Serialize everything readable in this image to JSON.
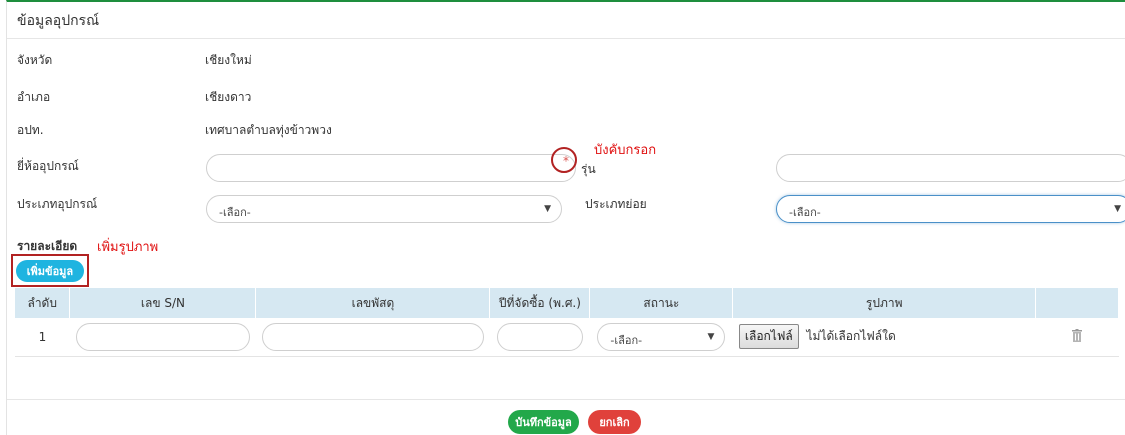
{
  "panel": {
    "title": "ข้อมูลอุปกรณ์"
  },
  "info": {
    "province_label": "จังหวัด",
    "province_value": "เชียงใหม่",
    "district_label": "อำเภอ",
    "district_value": "เชียงดาว",
    "org_label": "อปท.",
    "org_value": "เทศบาลตำบลทุ่งข้าวพวง"
  },
  "form": {
    "brand_label": "ยี่ห้ออุปกรณ์",
    "required_star": "*",
    "model_label": "รุ่น",
    "type_label": "ประเภทอุปกรณ์",
    "type_value": "-เลือก-",
    "subtype_label": "ประเภทย่อย",
    "subtype_value": "-เลือก-"
  },
  "annotations": {
    "required_note": "บังคับกรอก",
    "add_image_note": "เพิ่มรูปภาพ"
  },
  "details": {
    "heading": "รายละเอียด",
    "add_button": "เพิ่มข้อมูล"
  },
  "table": {
    "headers": {
      "no": "ลำดับ",
      "sn": "เลข S/N",
      "asset_no": "เลขพัสดุ",
      "year": "ปีที่จัดซื้อ (พ.ศ.)",
      "status": "สถานะ",
      "image": "รูปภาพ"
    },
    "rows": [
      {
        "no": "1",
        "status": "-เลือก-",
        "file_button": "เลือกไฟล์",
        "file_text": "ไม่ได้เลือกไฟล์ใด"
      }
    ]
  },
  "footer": {
    "save_button": "บันทึกข้อมูล",
    "cancel_button": "ยกเลิก"
  },
  "colors": {
    "save": "#22a84a",
    "cancel": "#e0413b",
    "add": "#1fb4e0",
    "annotation": "#e01010",
    "table_header": "#d6e8f2"
  },
  "icons": {
    "caret": "caret-down-icon",
    "trash": "trash-icon"
  }
}
